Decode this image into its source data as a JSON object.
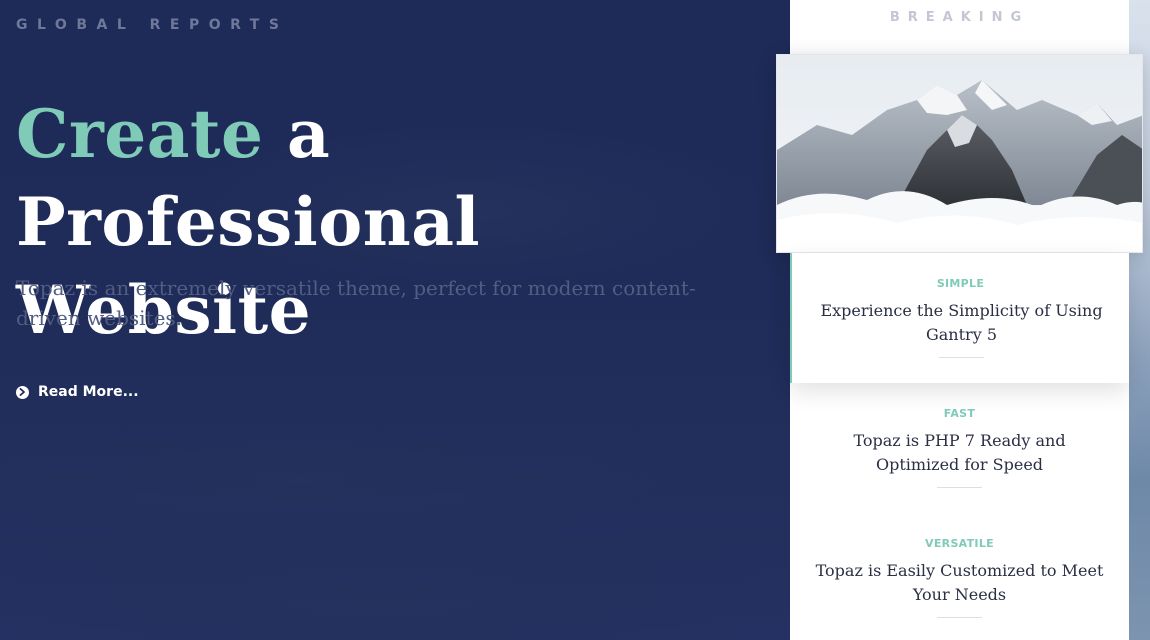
{
  "hero": {
    "tagline": "GLOBAL REPORTS",
    "headline_accent": "Create",
    "headline_rest": " a Professional Website",
    "description": "Topaz is an extremely versatile theme, perfect for modern content-driven websites.",
    "read_more": "Read More...",
    "read_more_icon": "chevron-circle-right-icon"
  },
  "breaking": {
    "label": "BREAKING",
    "image": "mountain-peaks-clouds",
    "items": [
      {
        "category": "SIMPLE",
        "title": "Experience the Simplicity of Using Gantry 5"
      },
      {
        "category": "FAST",
        "title": "Topaz is PHP 7 Ready and Optimized for Speed"
      },
      {
        "category": "VERSATILE",
        "title": "Topaz is Easily Customized to Meet Your Needs"
      }
    ]
  },
  "colors": {
    "hero_bg": "#1e2a57",
    "accent": "#7fcbb7",
    "tagline": "#6f7899",
    "description": "#525d83",
    "card_title": "#2b2f44"
  }
}
